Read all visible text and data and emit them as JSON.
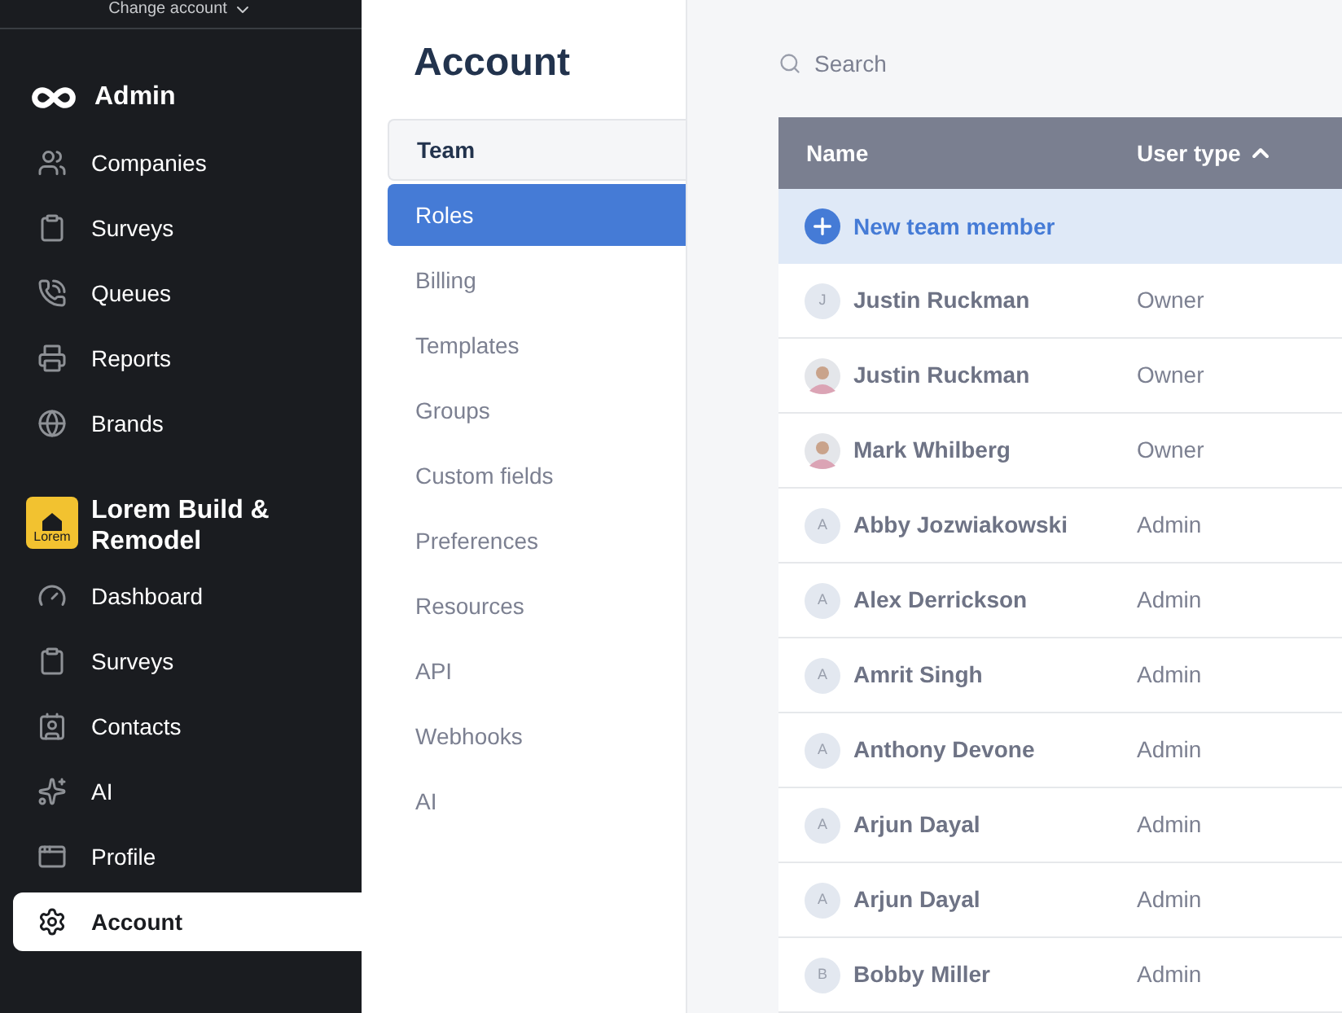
{
  "account_switcher": {
    "label": "Change account"
  },
  "sidebar": {
    "sections": [
      {
        "kind": "admin",
        "title": "Admin",
        "items": [
          {
            "label": "Companies",
            "selected": false
          },
          {
            "label": "Surveys",
            "selected": false
          },
          {
            "label": "Queues",
            "selected": false
          },
          {
            "label": "Reports",
            "selected": false
          },
          {
            "label": "Brands",
            "selected": false
          }
        ]
      },
      {
        "kind": "company",
        "title": "Lorem Build & Remodel",
        "logo_text": "Lorem",
        "items": [
          {
            "label": "Dashboard",
            "selected": false
          },
          {
            "label": "Surveys",
            "selected": false
          },
          {
            "label": "Contacts",
            "selected": false
          },
          {
            "label": "AI",
            "selected": false
          },
          {
            "label": "Profile",
            "selected": false
          },
          {
            "label": "Account",
            "selected": true
          }
        ]
      }
    ]
  },
  "subnav": {
    "title": "Account",
    "items": [
      {
        "label": "Team",
        "selected": false,
        "highlighted": true
      },
      {
        "label": "Roles",
        "selected": true,
        "highlighted": false
      },
      {
        "label": "Billing",
        "selected": false,
        "highlighted": false
      },
      {
        "label": "Templates",
        "selected": false,
        "highlighted": false
      },
      {
        "label": "Groups",
        "selected": false,
        "highlighted": false
      },
      {
        "label": "Custom fields",
        "selected": false,
        "highlighted": false
      },
      {
        "label": "Preferences",
        "selected": false,
        "highlighted": false
      },
      {
        "label": "Resources",
        "selected": false,
        "highlighted": false
      },
      {
        "label": "API",
        "selected": false,
        "highlighted": false
      },
      {
        "label": "Webhooks",
        "selected": false,
        "highlighted": false
      },
      {
        "label": "AI",
        "selected": false,
        "highlighted": false
      }
    ]
  },
  "search": {
    "placeholder": "Search"
  },
  "table": {
    "columns": [
      {
        "label": "Name",
        "sorted": false
      },
      {
        "label": "User type",
        "sorted": true
      }
    ],
    "new_row": {
      "label": "New team member"
    },
    "rows": [
      {
        "avatar": {
          "kind": "initial",
          "initial": "J"
        },
        "name": "Justin Ruckman",
        "user_type": "Owner"
      },
      {
        "name": "Justin Ruckman",
        "user_type": "Owner"
      },
      {
        "name": "Mark Whilberg",
        "user_type": "Owner"
      },
      {
        "avatar": {
          "kind": "initial",
          "initial": "A"
        },
        "name": "Abby Jozwiakowski",
        "user_type": "Admin"
      },
      {
        "avatar": {
          "kind": "initial",
          "initial": "A"
        },
        "name": "Alex Derrickson",
        "user_type": "Admin"
      },
      {
        "avatar": {
          "kind": "initial",
          "initial": "A"
        },
        "name": "Amrit Singh",
        "user_type": "Admin"
      },
      {
        "avatar": {
          "kind": "initial",
          "initial": "A"
        },
        "name": "Anthony Devone",
        "user_type": "Admin"
      },
      {
        "avatar": {
          "kind": "initial",
          "initial": "A"
        },
        "name": "Arjun Dayal",
        "user_type": "Admin"
      },
      {
        "avatar": {
          "kind": "initial",
          "initial": "A"
        },
        "name": "Arjun Dayal",
        "user_type": "Admin"
      },
      {
        "avatar": {
          "kind": "initial",
          "initial": "B"
        },
        "name": "Bobby Miller",
        "user_type": "Admin"
      }
    ]
  }
}
